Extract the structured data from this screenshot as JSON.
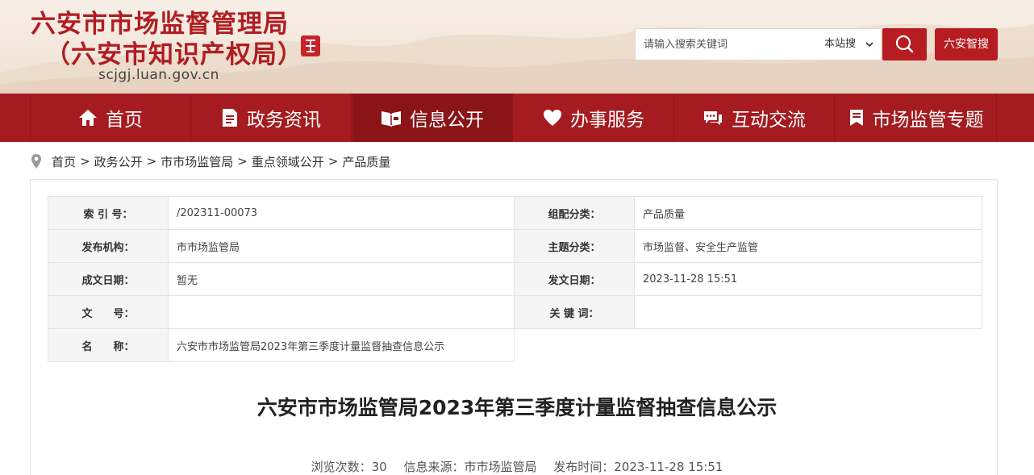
{
  "header": {
    "site_name_line1": "六安市市场监督管理局",
    "site_name_line2": "（六安市知识产权局）",
    "domain": "scjgj.luan.gov.cn",
    "search_placeholder": "请输入搜索关键词",
    "search_scope": "本站搜",
    "smart_search_label": "六安智搜"
  },
  "nav": {
    "items": [
      {
        "label": "首页",
        "icon": "home-icon"
      },
      {
        "label": "政务资讯",
        "icon": "document-icon"
      },
      {
        "label": "信息公开",
        "icon": "open-book-icon"
      },
      {
        "label": "办事服务",
        "icon": "heart-icon"
      },
      {
        "label": "互动交流",
        "icon": "chat-icon"
      },
      {
        "label": "市场监管专题",
        "icon": "bookmark-icon"
      }
    ],
    "active_index": 2
  },
  "breadcrumb": [
    "首页",
    "政务公开",
    "市市场监管局",
    "重点领域公开",
    "产品质量"
  ],
  "meta": {
    "index_no_label": "索 引 号：",
    "index_no": "/202311-00073",
    "category_label": "组配分类：",
    "category": "产品质量",
    "publisher_label": "发布机构：",
    "publisher": "市市场监管局",
    "topic_label": "主题分类：",
    "topic": "市场监督、安全生产监管",
    "created_label": "成文日期：",
    "created": "暂无",
    "issued_label": "发文日期：",
    "issued": "2023-11-28 15:51",
    "doc_no_label": "文　　号：",
    "doc_no": "",
    "keywords_label": "关 键 词：",
    "keywords": "",
    "name_label": "名　　称：",
    "name": "六安市市场监管局2023年第三季度计量监督抽查信息公示"
  },
  "document": {
    "title": "六安市市场监管局2023年第三季度计量监督抽查信息公示",
    "views": "浏览次数：30",
    "source": "信息来源：市市场监管局",
    "published": "发布时间：2023-11-28 15:51"
  },
  "colors": {
    "brand_red": "#a51b1f",
    "active_nav": "#8a1418",
    "header_bg": "#f3e7dc"
  }
}
